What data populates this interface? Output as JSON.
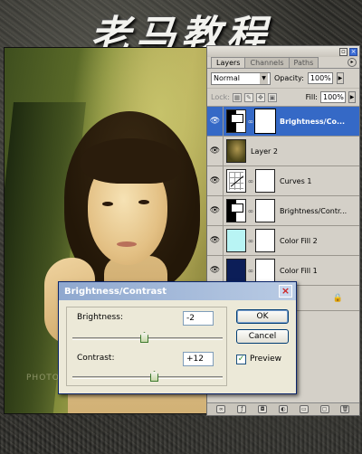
{
  "banner": {
    "title": "老马教程"
  },
  "photo": {
    "watermark": "PHOTO ma"
  },
  "panel": {
    "tabs": [
      {
        "label": "Layers",
        "active": true
      },
      {
        "label": "Channels",
        "active": false
      },
      {
        "label": "Paths",
        "active": false
      }
    ],
    "blend_mode": "Normal",
    "opacity_label": "Opacity:",
    "opacity_value": "100%",
    "lock_label": "Lock:",
    "fill_label": "Fill:",
    "fill_value": "100%",
    "layers": [
      {
        "name": "Brightness/Co...",
        "thumb": "brightness-contrast",
        "has_mask": true,
        "selected": true
      },
      {
        "name": "Layer 2",
        "thumb": "photo",
        "has_mask": false,
        "selected": false
      },
      {
        "name": "Curves 1",
        "thumb": "curves",
        "has_mask": true,
        "selected": false
      },
      {
        "name": "Brightness/Contr...",
        "thumb": "brightness-contrast",
        "has_mask": true,
        "selected": false
      },
      {
        "name": "Color Fill 2",
        "thumb": "color-fill",
        "thumb_color": "#b8f4f4",
        "has_mask": true,
        "selected": false
      },
      {
        "name": "Color Fill 1",
        "thumb": "color-fill",
        "thumb_color": "#0c1e58",
        "has_mask": true,
        "selected": false
      }
    ]
  },
  "dialog": {
    "title": "Brightness/Contrast",
    "brightness_label": "Brightness:",
    "brightness_value": "-2",
    "contrast_label": "Contrast:",
    "contrast_value": "+12",
    "ok_label": "OK",
    "cancel_label": "Cancel",
    "preview_label": "Preview",
    "preview_checked": true
  }
}
